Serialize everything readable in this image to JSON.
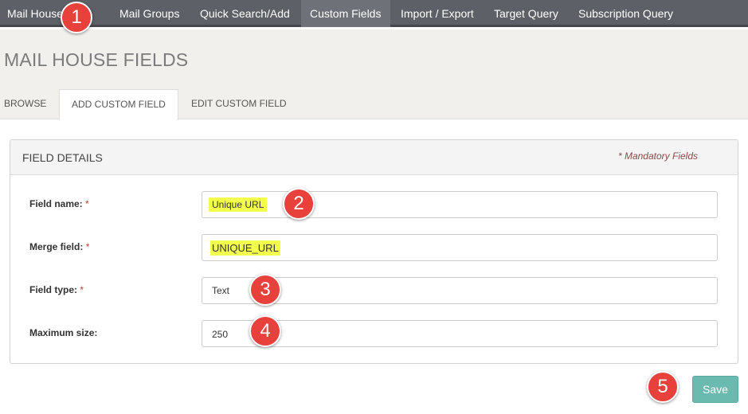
{
  "nav": {
    "items": [
      {
        "label": "Mail House"
      },
      {
        "label": "Mail Groups"
      },
      {
        "label": "Quick Search/Add"
      },
      {
        "label": "Custom Fields"
      },
      {
        "label": "Import / Export"
      },
      {
        "label": "Target Query"
      },
      {
        "label": "Subscription Query"
      }
    ],
    "active": "Custom Fields"
  },
  "page": {
    "title": "MAIL HOUSE FIELDS"
  },
  "tabs": [
    {
      "label": "BROWSE"
    },
    {
      "label": "ADD CUSTOM FIELD"
    },
    {
      "label": "EDIT CUSTOM FIELD"
    }
  ],
  "panel": {
    "title": "FIELD DETAILS",
    "mandatory_note": "* Mandatory Fields",
    "required_marker": "*",
    "fields": [
      {
        "label": "Field name:",
        "value": "Unique URL",
        "required": true
      },
      {
        "label": "Merge field:",
        "value": "UNIQUE_URL",
        "required": true
      },
      {
        "label": "Field type:",
        "value": "Text",
        "required": true
      },
      {
        "label": "Maximum size:",
        "value": "250",
        "required": false
      }
    ]
  },
  "actions": {
    "save_label": "Save"
  },
  "callouts": [
    "1",
    "2",
    "3",
    "4",
    "5"
  ],
  "colors": {
    "callout": "#e8413c",
    "highlight": "#f3ff4d",
    "save_button": "#6bbab0",
    "nav_bg": "#5d6066"
  }
}
